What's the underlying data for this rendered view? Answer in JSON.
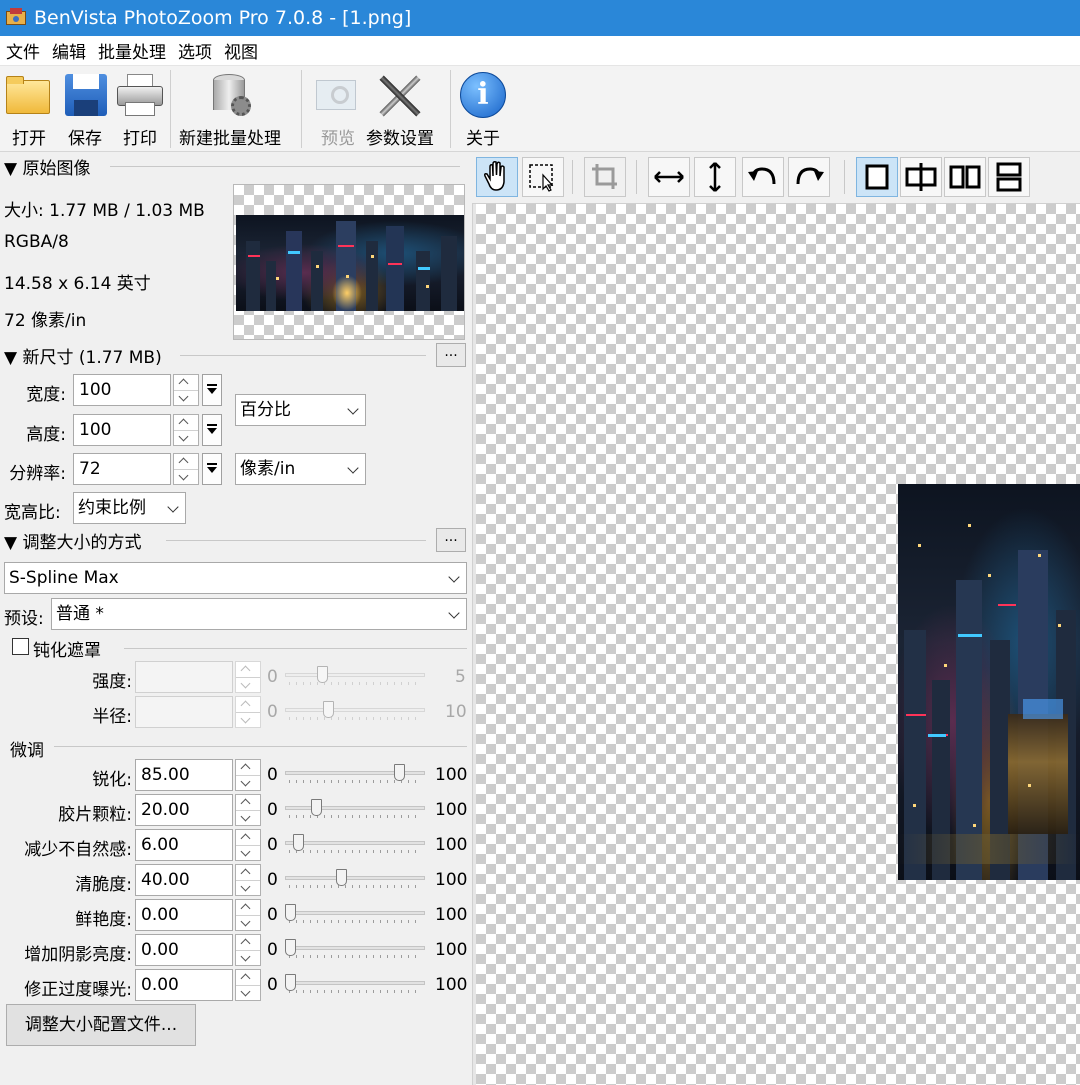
{
  "window": {
    "title": "BenVista PhotoZoom Pro 7.0.8 - [1.png]"
  },
  "menu": [
    "文件",
    "编辑",
    "批量处理",
    "选项",
    "视图"
  ],
  "toolbar": {
    "open": "打开",
    "save": "保存",
    "print": "打印",
    "batch": "新建批量处理",
    "preview": "预览",
    "settings": "参数设置",
    "about": "关于"
  },
  "original": {
    "header": "▼ 原始图像",
    "size": "大小: 1.77 MB / 1.03 MB",
    "mode": "RGBA/8",
    "dimensions": "14.58 x 6.14 英寸",
    "resolution": "72 像素/in"
  },
  "new_size": {
    "header": "▼ 新尺寸 (1.77 MB)",
    "more_button": "...",
    "width_label": "宽度:",
    "width_value": "100",
    "height_label": "高度:",
    "height_value": "100",
    "unit": "百分比",
    "resolution_label": "分辨率:",
    "resolution_value": "72",
    "resolution_unit": "像素/in",
    "aspect_label": "宽高比:",
    "aspect_value": "约束比例"
  },
  "resize_method": {
    "header": "▼ 调整大小的方式",
    "more_button": "...",
    "method": "S-Spline Max",
    "preset_label": "预设:",
    "preset_value": "普通 *"
  },
  "unsharp": {
    "label": "钝化遮罩",
    "strength_label": "强度:",
    "strength_min": "0",
    "strength_max": "5",
    "strength_level": 0.25,
    "radius_label": "半径:",
    "radius_min": "0",
    "radius_max": "10",
    "radius_level": 0.3
  },
  "fine_tune": {
    "header": "微调",
    "rows": [
      {
        "label": "锐化:",
        "value": "85.00",
        "min": "0",
        "max": "100",
        "level": 0.85
      },
      {
        "label": "胶片颗粒:",
        "value": "20.00",
        "min": "0",
        "max": "100",
        "level": 0.2
      },
      {
        "label": "减少不自然感:",
        "value": "6.00",
        "min": "0",
        "max": "100",
        "level": 0.06
      },
      {
        "label": "清脆度:",
        "value": "40.00",
        "min": "0",
        "max": "100",
        "level": 0.4
      },
      {
        "label": "鲜艳度:",
        "value": "0.00",
        "min": "0",
        "max": "100",
        "level": 0.0
      },
      {
        "label": "增加阴影亮度:",
        "value": "0.00",
        "min": "0",
        "max": "100",
        "level": 0.0
      },
      {
        "label": "修正过度曝光:",
        "value": "0.00",
        "min": "0",
        "max": "100",
        "level": 0.0
      }
    ]
  },
  "profile_button": "调整大小配置文件..."
}
